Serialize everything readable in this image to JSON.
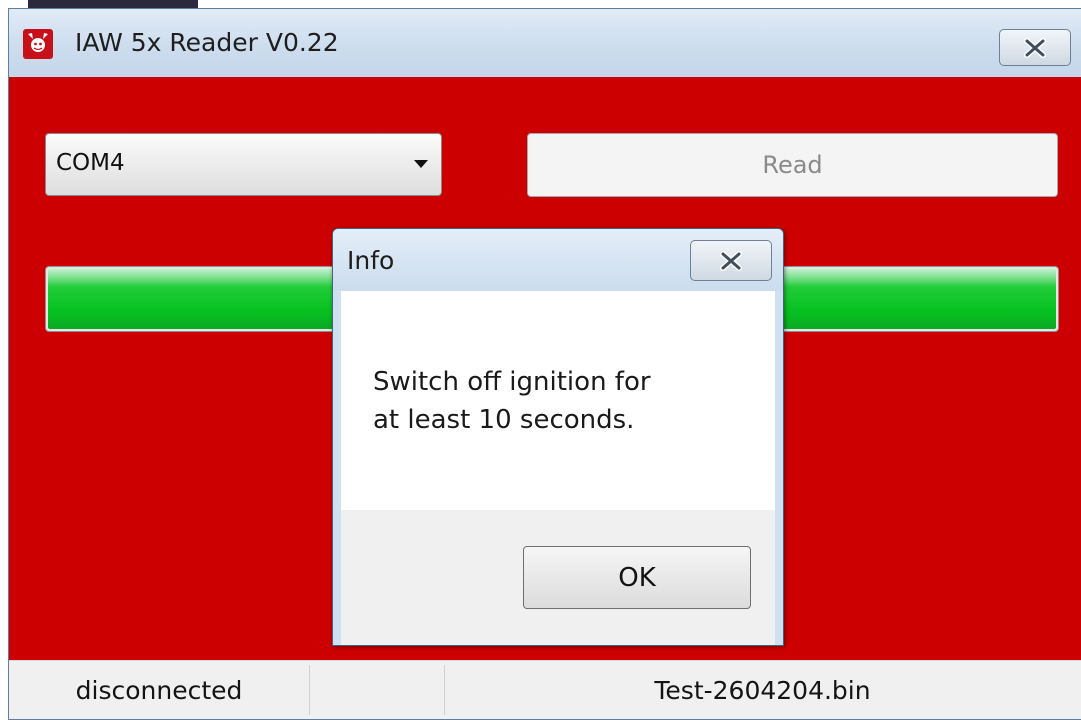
{
  "window": {
    "title": "IAW 5x Reader V0.22",
    "icon": "devil-logo-icon",
    "close_icon": "close-icon"
  },
  "controls": {
    "port_select": {
      "selected": "COM4",
      "icon": "chevron-down-icon"
    },
    "read_label": "Read",
    "progress_fraction": 1.0,
    "progress_color": "#06c11f"
  },
  "dialog": {
    "title": "Info",
    "message_lines": [
      "Switch off ignition for",
      "at least 10 seconds."
    ],
    "ok_label": "OK",
    "close_icon": "close-icon"
  },
  "status": {
    "connection": "disconnected",
    "middle": "",
    "file": "Test-2604204.bin"
  },
  "colors": {
    "client_bg": "#cc0000",
    "titlebar": "#cddcee"
  }
}
